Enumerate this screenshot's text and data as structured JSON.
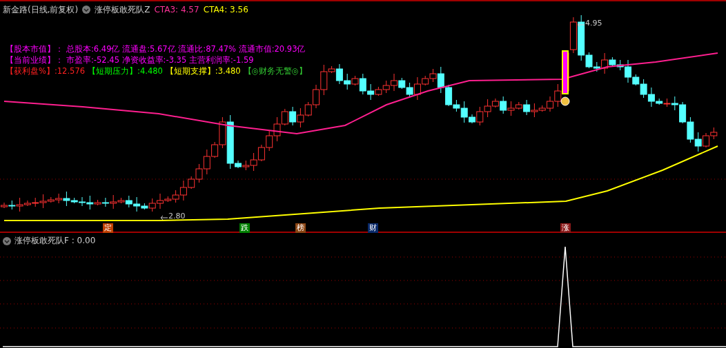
{
  "main_panel": {
    "title": "新金路(日线,前复权)",
    "indicator": "涨停板敢死队Z",
    "values": [
      {
        "text": "CTA3: 4.57",
        "color": "#ff3399"
      },
      {
        "text": "CTA4: 3.56",
        "color": "#ffff00"
      }
    ],
    "info_lines": [
      [
        {
          "text": "【股本市值】：",
          "color": "#ff00ff"
        },
        {
          "text": "总股本:6.49亿 流通盘:5.67亿 流通比:87.47% 流通市值:20.93亿",
          "color": "#ff00ff"
        }
      ],
      [
        {
          "text": "【当前业绩】：",
          "color": "#ff00ff"
        },
        {
          "text": "市盈率:-52.45 净资收益率:-3.35 主营利润率:-1.59",
          "color": "#ff00ff"
        }
      ],
      [
        {
          "text": "【获利盘%】:12.576",
          "color": "#ff2020"
        },
        {
          "text": "【短期压力】:4.480",
          "color": "#00ff00"
        },
        {
          "text": "【短期支撑】:3.480",
          "color": "#ffff00"
        },
        {
          "text": "【◎财务无警◎】",
          "color": "#33cc33"
        }
      ]
    ],
    "price_labels": [
      "4.95",
      "2.80"
    ],
    "markers": [
      {
        "label": "定",
        "color": "#c04000"
      },
      {
        "label": "跌",
        "color": "#008000"
      },
      {
        "label": "榜",
        "color": "#8b4513"
      },
      {
        "label": "财",
        "color": "#0a2a6a"
      },
      {
        "label": "涨",
        "color": "#8b1a1a"
      }
    ]
  },
  "sub_panel": {
    "title": "涨停板敢死队F : 0.00"
  }
}
